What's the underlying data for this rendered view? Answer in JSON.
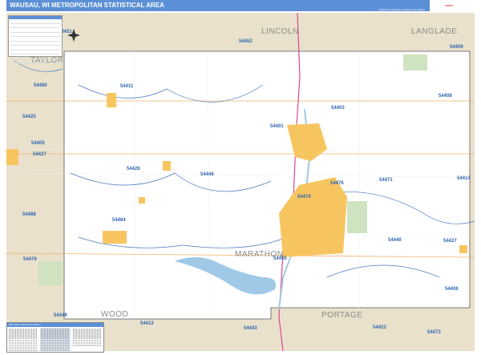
{
  "header": {
    "title": "WAUSAU, WI METROPOLITAN STATISTICAL AREA",
    "subtitle": "2020 ZIP Code Business Reference Edition",
    "logo_text": "MAPS"
  },
  "colors": {
    "header": "#5b8fd6",
    "county_fill": "#ffffff",
    "outside_fill": "#e9e1cc",
    "city": "#f7c560",
    "zip_label": "#2f66b0",
    "water": "#9fc9e6",
    "park": "#cfe3c0",
    "highway": "#e0468f",
    "road": "#f0b46a",
    "boundary": "#4a78c0"
  },
  "counties": [
    "TAYLOR",
    "LINCOLN",
    "LANGLADE",
    "MARATHON",
    "WOOD",
    "PORTAGE"
  ],
  "zips": [
    "54451",
    "54452",
    "54409",
    "54480",
    "54411",
    "54408",
    "54425",
    "54403",
    "54401",
    "54405",
    "54427",
    "54426",
    "54448",
    "54476",
    "54471",
    "54414",
    "54474",
    "54488",
    "54484",
    "54440",
    "54427",
    "54479",
    "54455",
    "54406",
    "54449",
    "54412",
    "54443",
    "54423",
    "54473"
  ],
  "index": {
    "title": "ZIP Code Index/Grid Location"
  },
  "compass_icon": "compass-rose"
}
